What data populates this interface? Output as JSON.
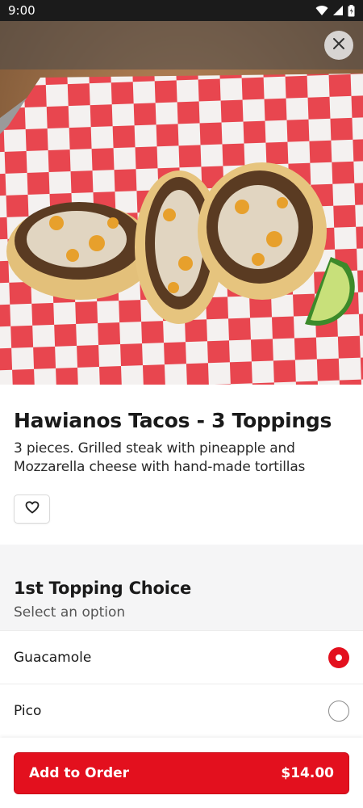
{
  "status_bar": {
    "time": "9:00",
    "icons": [
      "wifi-icon",
      "signal-icon",
      "battery-icon"
    ]
  },
  "hero": {
    "image": "tacos-photo",
    "close_icon": "close-icon"
  },
  "item": {
    "title": "Hawianos Tacos - 3 Toppings",
    "description_line1": "3 pieces. Grilled steak with pineapple and",
    "description_line2": "Mozzarella cheese with hand-made tortillas",
    "favorite_icon": "heart-outline-icon"
  },
  "option_group": {
    "title": "1st Topping Choice",
    "subtitle": "Select an option",
    "options": [
      {
        "label": "Guacamole",
        "selected": true
      },
      {
        "label": "Pico",
        "selected": false
      }
    ]
  },
  "order_button": {
    "label": "Add to Order",
    "price": "$14.00"
  },
  "colors": {
    "accent": "#e3101e",
    "status_bar": "#1b1b1b",
    "section_bg": "#f5f5f6"
  }
}
